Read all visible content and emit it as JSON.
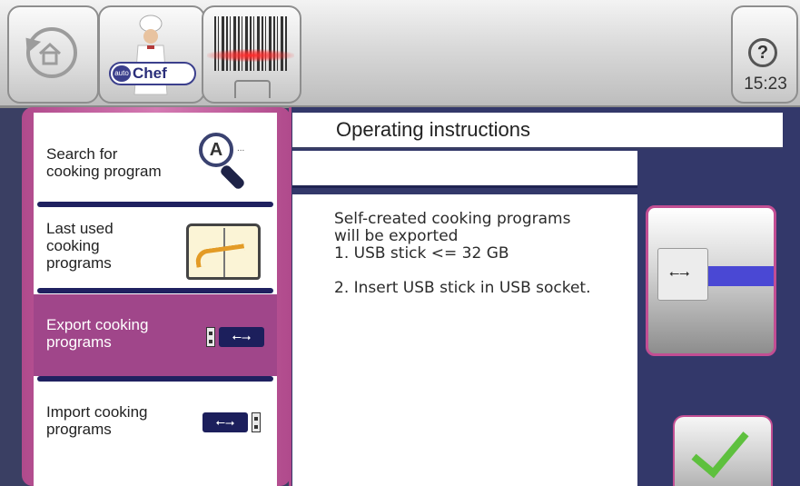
{
  "topbar": {
    "back_icon": "back-home-icon",
    "brand_badge_prefix": "auto",
    "brand_badge_name": "Chef",
    "scanner_icon": "barcode-scanner-icon",
    "help_symbol": "?",
    "clock": "15:23"
  },
  "menu": {
    "items": [
      {
        "label_lines": [
          "Search for",
          "cooking program"
        ],
        "icon": "search-magnifier-icon",
        "active": false
      },
      {
        "label_lines": [
          "Last used",
          "cooking",
          "programs"
        ],
        "icon": "open-book-icon",
        "active": false
      },
      {
        "label_lines": [
          "Export cooking",
          "programs"
        ],
        "icon": "usb-export-icon",
        "active": true
      },
      {
        "label_lines": [
          "Import cooking",
          "programs"
        ],
        "icon": "usb-import-icon",
        "active": false
      }
    ],
    "search_icon_letter": "A",
    "search_icon_dots": "...",
    "usb_symbol": "⭠⭢"
  },
  "main": {
    "title": "Operating instructions",
    "subtitle": "",
    "instructions": [
      "Self-created cooking programs",
      "will be exported",
      "1. USB stick <= 32 GB",
      "",
      "2. Insert USB stick in USB socket."
    ],
    "image_icon": "usb-stick-photo",
    "image_symbol": "⭠⭢",
    "confirm_icon": "checkmark-icon"
  },
  "colors": {
    "accent": "#a0468a",
    "frame": "#33386a",
    "check": "#5ec03e"
  }
}
